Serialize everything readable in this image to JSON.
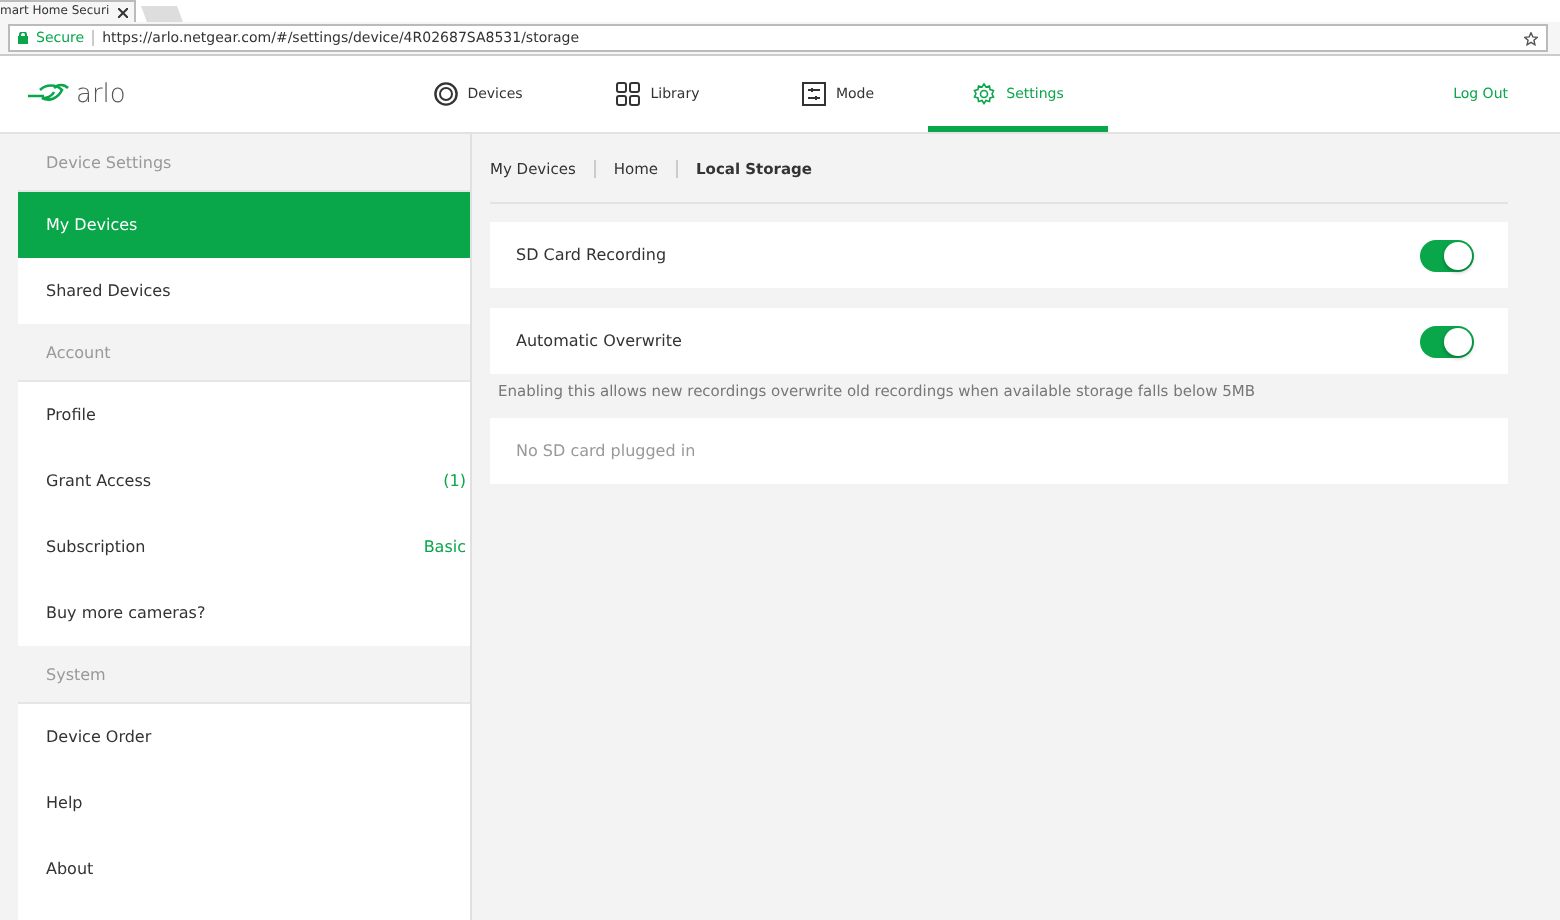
{
  "browser": {
    "tab_title": "mart Home Securi",
    "secure_label": "Secure",
    "url": "https://arlo.netgear.com/#/settings/device/4R02687SA8531/storage"
  },
  "nav": {
    "logo": "arlo",
    "tabs": [
      {
        "kind": "devices",
        "label": "Devices",
        "selected": false
      },
      {
        "kind": "library",
        "label": "Library",
        "selected": false
      },
      {
        "kind": "mode",
        "label": "Mode",
        "selected": false
      },
      {
        "kind": "settings",
        "label": "Settings",
        "selected": true
      }
    ],
    "logout": "Log Out"
  },
  "sidebar": [
    {
      "header": "Device Settings",
      "items": [
        {
          "label": "My Devices",
          "selected": true
        },
        {
          "label": "Shared Devices",
          "selected": false
        }
      ]
    },
    {
      "header": "Account",
      "items": [
        {
          "label": "Profile",
          "selected": false
        },
        {
          "label": "Grant Access",
          "value": "(1)",
          "selected": false
        },
        {
          "label": "Subscription",
          "value": "Basic",
          "selected": false
        },
        {
          "label": "Buy more cameras?",
          "selected": false
        }
      ]
    },
    {
      "header": "System",
      "items": [
        {
          "label": "Device Order",
          "selected": false
        },
        {
          "label": "Help",
          "selected": false
        },
        {
          "label": "About",
          "selected": false
        }
      ]
    }
  ],
  "breadcrumb": [
    {
      "label": "My Devices",
      "current": false
    },
    {
      "label": "Home",
      "current": false
    },
    {
      "label": "Local Storage",
      "current": true
    }
  ],
  "settings": [
    {
      "kind": "toggle",
      "label": "SD Card Recording",
      "on": true
    },
    {
      "kind": "toggle",
      "label": "Automatic Overwrite",
      "on": true
    },
    {
      "kind": "note",
      "label": "Enabling this allows new recordings overwrite old recordings when available storage falls below 5MB"
    },
    {
      "kind": "info",
      "label": "No SD card plugged in"
    }
  ]
}
